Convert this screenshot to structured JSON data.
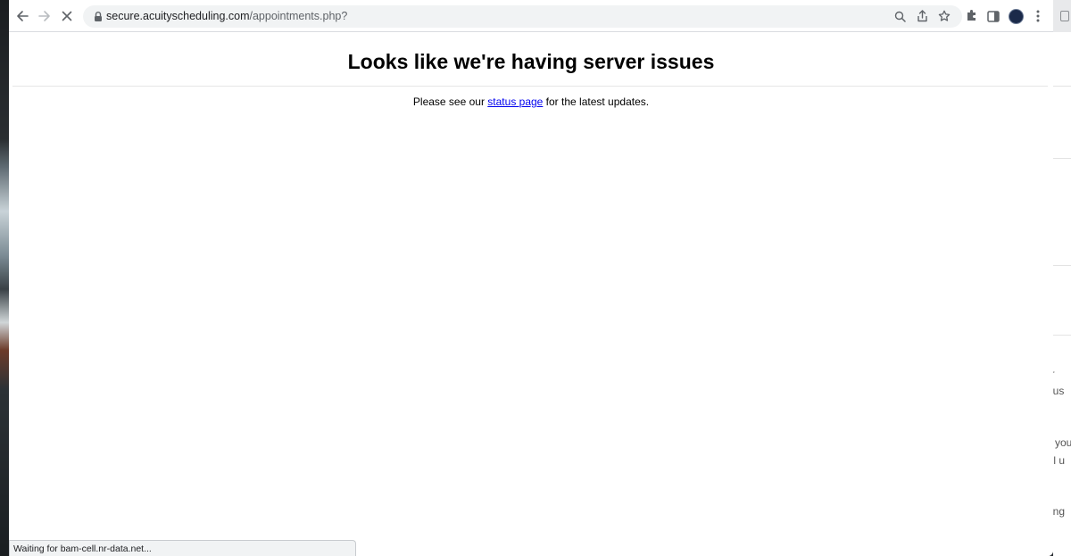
{
  "browser": {
    "url_host": "secure.acuityscheduling.com",
    "url_path": "/appointments.php?",
    "status_text": "Waiting for bam-cell.nr-data.net..."
  },
  "page": {
    "title": "Looks like we're having server issues",
    "message_before": "Please see our ",
    "status_link": "status page",
    "message_after": " for the latest updates."
  },
  "background_fragments": [
    "ur",
    "ll us",
    "you",
    "all u",
    "ring"
  ],
  "icons": {
    "back": "back-arrow-icon",
    "forward": "forward-arrow-icon",
    "stop": "stop-loading-icon",
    "lock": "lock-icon",
    "zoom": "zoom-icon",
    "share": "share-icon",
    "bookmark": "star-icon",
    "extensions": "puzzle-icon",
    "side_panel": "side-panel-icon",
    "profile": "avatar",
    "menu": "kebab-menu-icon"
  },
  "colors": {
    "link": "#0000ee",
    "omnibox": "#f1f3f4",
    "toolbar_icon": "#5f6368"
  }
}
